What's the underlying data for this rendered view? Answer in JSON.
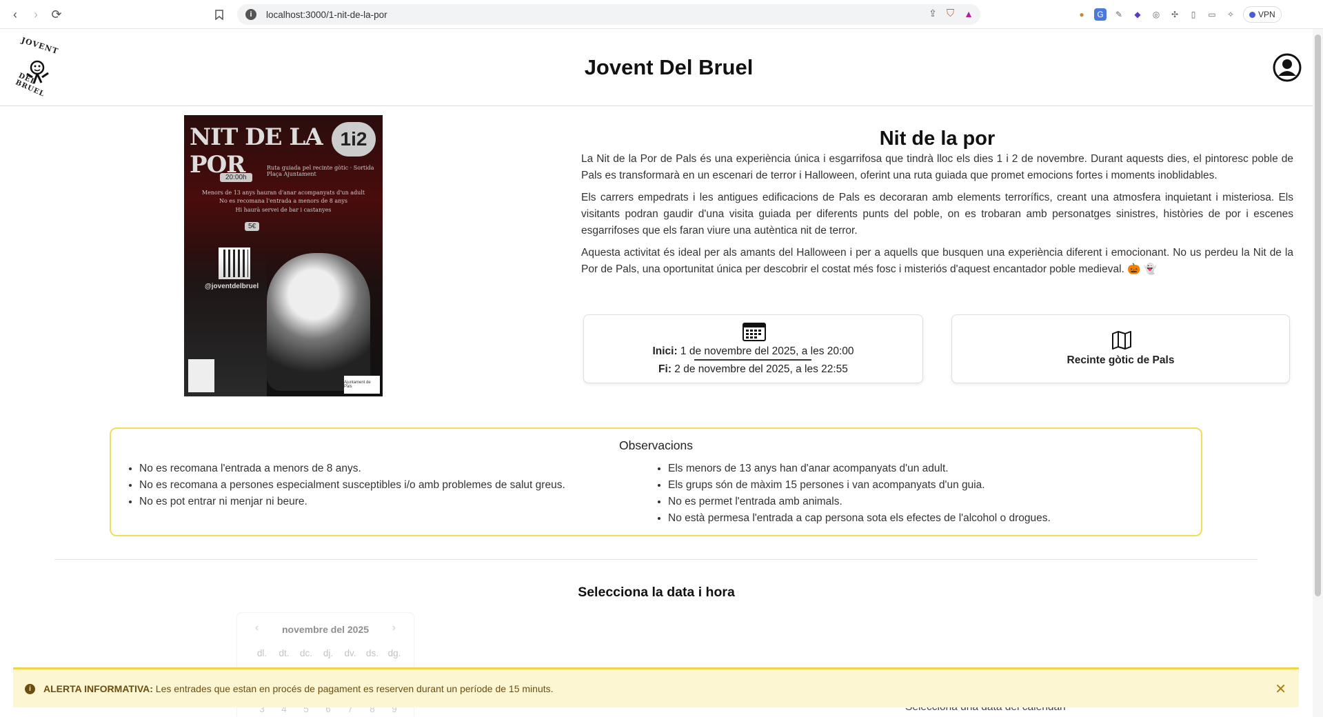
{
  "browser": {
    "url": "localhost:3000/1-nit-de-la-por",
    "vpn_label": "VPN"
  },
  "site": {
    "title": "Jovent Del Bruel",
    "logo_text_top": "JOVENT",
    "logo_text_bottom": "DEL BRUEL"
  },
  "poster": {
    "title": "NIT DE LA POR",
    "dates_badge": "1i2",
    "time": "20:00h",
    "line_route": "Ruta guiada pel recinte gòtic · Sortida Plaça Ajuntament",
    "line_minors": "Menors de 13 anys hauran d'anar acompanyats d'un adult",
    "line_notrec": "No es recomana l'entrada a menors de 8 anys",
    "line_bar": "Hi haurà servei de bar i castanyes",
    "price": "5€",
    "handle": "@joventdelbruel",
    "ajuntament": "Ajuntament de Pals"
  },
  "event": {
    "title": "Nit de la por",
    "paragraphs": [
      "La Nit de la Por de Pals és una experiència única i esgarrifosa que tindrà lloc els dies 1 i 2 de novembre. Durant aquests dies, el pintoresc poble de Pals es transformarà en un escenari de terror i Halloween, oferint una ruta guiada que promet emocions fortes i moments inoblidables.",
      "Els carrers empedrats i les antigues edificacions de Pals es decoraran amb elements terrorífics, creant una atmosfera inquietant i misteriosa. Els visitants podran gaudir d'una visita guiada per diferents punts del poble, on es trobaran amb personatges sinistres, històries de por i escenes esgarrifoses que els faran viure una autèntica nit de terror.",
      "Aquesta activitat és ideal per als amants del Halloween i per a aquells que busquen una experiència diferent i emocionant. No us perdeu la Nit de la Por de Pals, una oportunitat única per descobrir el costat més fosc i misteriós d'aquest encantador poble medieval. 🎃 👻"
    ],
    "start_label": "Inici:",
    "start_value": "1 de novembre del 2025, a les 20:00",
    "end_label": "Fi:",
    "end_value": "2 de novembre del 2025, a les 22:55",
    "place": "Recinte gòtic de Pals"
  },
  "observations": {
    "title": "Observacions",
    "left": [
      "No es recomana l'entrada a menors de 8 anys.",
      "No es recomana a persones especialment susceptibles i/o amb problemes de salut greus.",
      "No es pot entrar ni menjar ni beure."
    ],
    "right": [
      "Els menors de 13 anys han d'anar acompanyats d'un adult.",
      "Els grups són de màxim 15 persones i van acompanyats d'un guia.",
      "No es permet l'entrada amb animals.",
      "No està permesa l'entrada a cap persona sota els efectes de l'alcohol o drogues."
    ]
  },
  "booking": {
    "title": "Selecciona la data i hora",
    "calendar_month": "novembre del 2025",
    "weekdays": [
      "dl.",
      "dt.",
      "dc.",
      "dj.",
      "dv.",
      "ds.",
      "dg."
    ],
    "visible_days": [
      "3",
      "4",
      "5",
      "6",
      "7",
      "8",
      "9"
    ],
    "hint": "Selecciona una data del calendari"
  },
  "alert": {
    "label": "ALERTA INFORMATIVA:",
    "message": "Les entrades que estan en procés de pagament es reserven durant un període de 15 minuts."
  },
  "colors": {
    "alert_bg": "#fdf6d3",
    "alert_border": "#f0d449",
    "obs_border": "#f3dc58"
  }
}
